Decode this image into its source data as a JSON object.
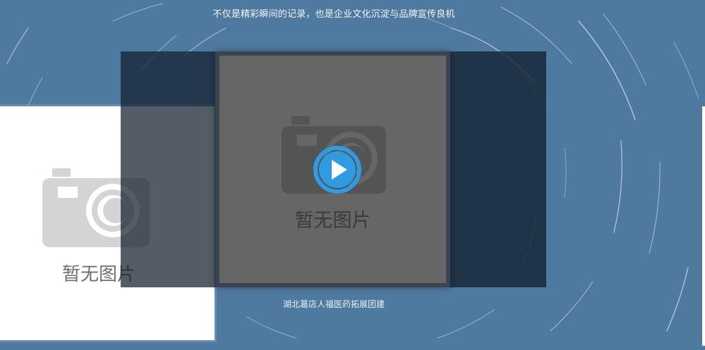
{
  "header": {
    "subtitle": "不仅是精彩瞬间的记录，也是企业文化沉淀与品牌宣传良机"
  },
  "carousel": {
    "placeholder_label": "暂无图片",
    "active_caption": "湖北葛店人福医药拓展团建"
  },
  "colors": {
    "background": "#4f7aa0",
    "play_accent": "#2f9be0"
  }
}
